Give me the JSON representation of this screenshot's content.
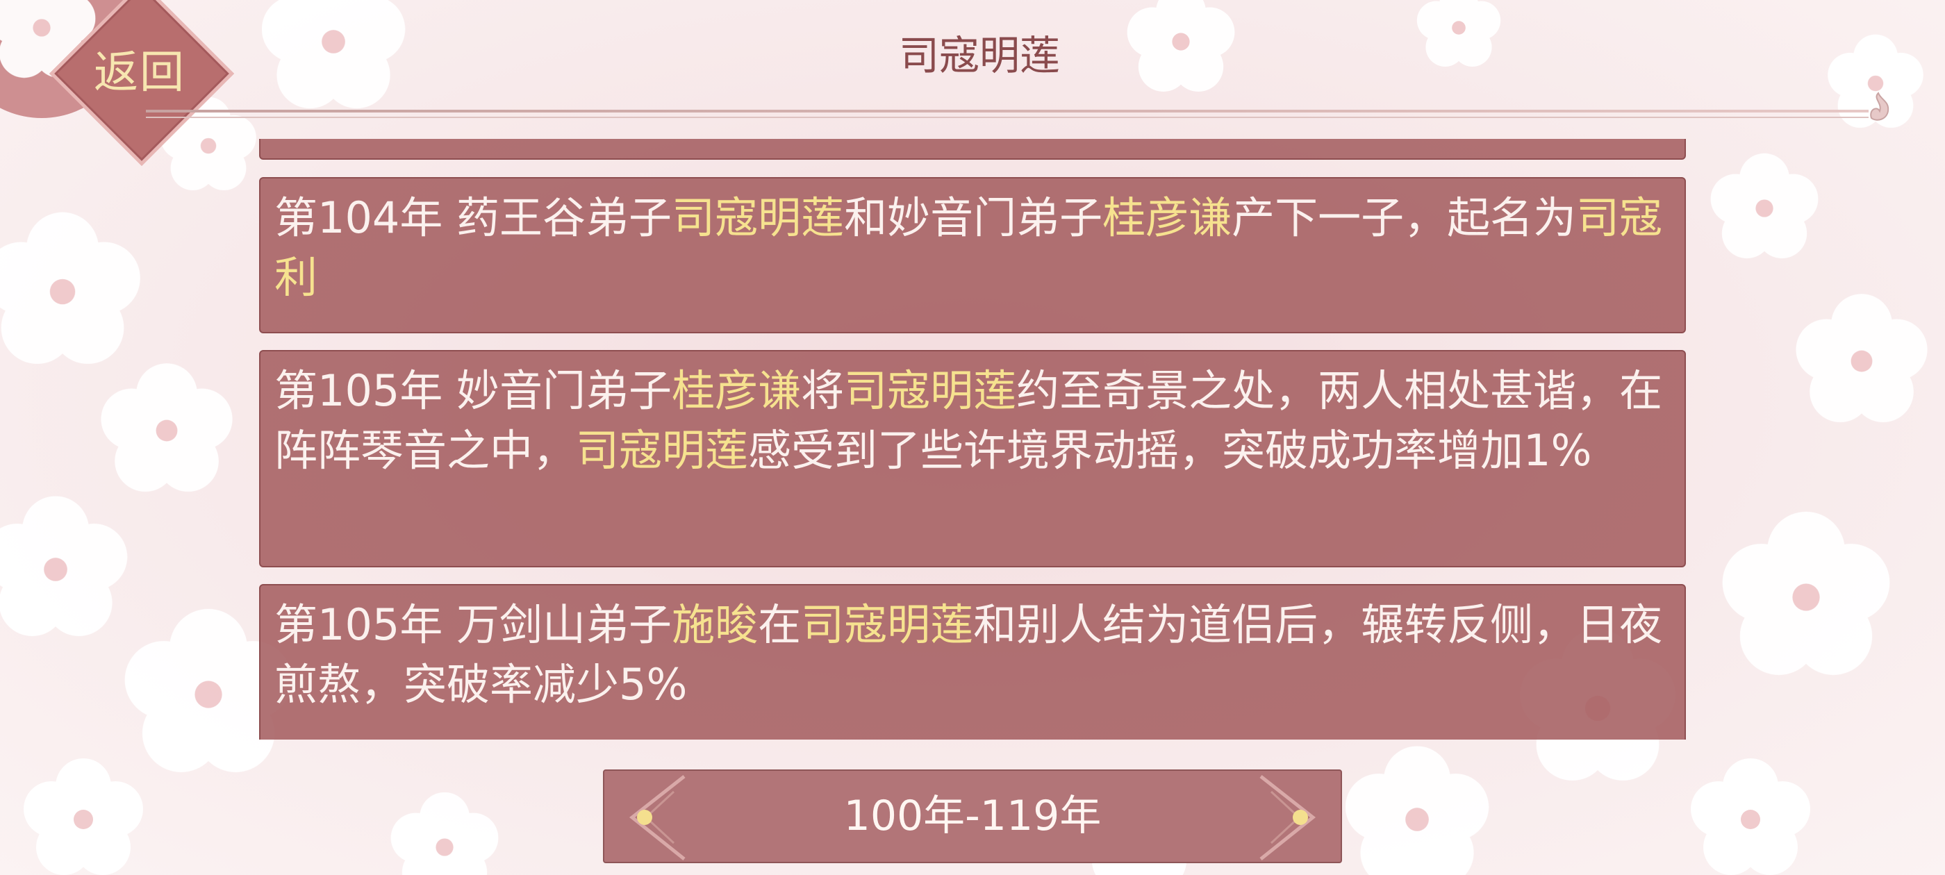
{
  "header": {
    "back_label": "返回",
    "title": "司寇明莲"
  },
  "events": [
    {
      "segments": [
        {
          "t": "第104年 药王谷弟子",
          "hl": false
        },
        {
          "t": "司寇明莲",
          "hl": true
        },
        {
          "t": "和妙音门弟子",
          "hl": false
        },
        {
          "t": "桂彦谦",
          "hl": true
        },
        {
          "t": "产下一子，起名为",
          "hl": false
        },
        {
          "t": "司寇利",
          "hl": true
        }
      ]
    },
    {
      "segments": [
        {
          "t": "第105年 妙音门弟子",
          "hl": false
        },
        {
          "t": "桂彦谦",
          "hl": true
        },
        {
          "t": "将",
          "hl": false
        },
        {
          "t": "司寇明莲",
          "hl": true
        },
        {
          "t": "约至奇景之处，两人相处甚谐，在阵阵琴音之中，",
          "hl": false
        },
        {
          "t": "司寇明莲",
          "hl": true
        },
        {
          "t": "感受到了些许境界动摇，突破成功率增加1%",
          "hl": false
        }
      ]
    },
    {
      "segments": [
        {
          "t": "第105年 万剑山弟子",
          "hl": false
        },
        {
          "t": "施晙",
          "hl": true
        },
        {
          "t": "在",
          "hl": false
        },
        {
          "t": "司寇明莲",
          "hl": true
        },
        {
          "t": "和别人结为道侣后，辗转反侧，日夜煎熬，突破率减少5%",
          "hl": false
        }
      ]
    }
  ],
  "range_selector": {
    "label": "100年-119年"
  },
  "colors": {
    "card_bg": "#a55f61",
    "highlight": "#f6e28f",
    "text": "#fbf1ee",
    "title": "#8a4b4d"
  }
}
